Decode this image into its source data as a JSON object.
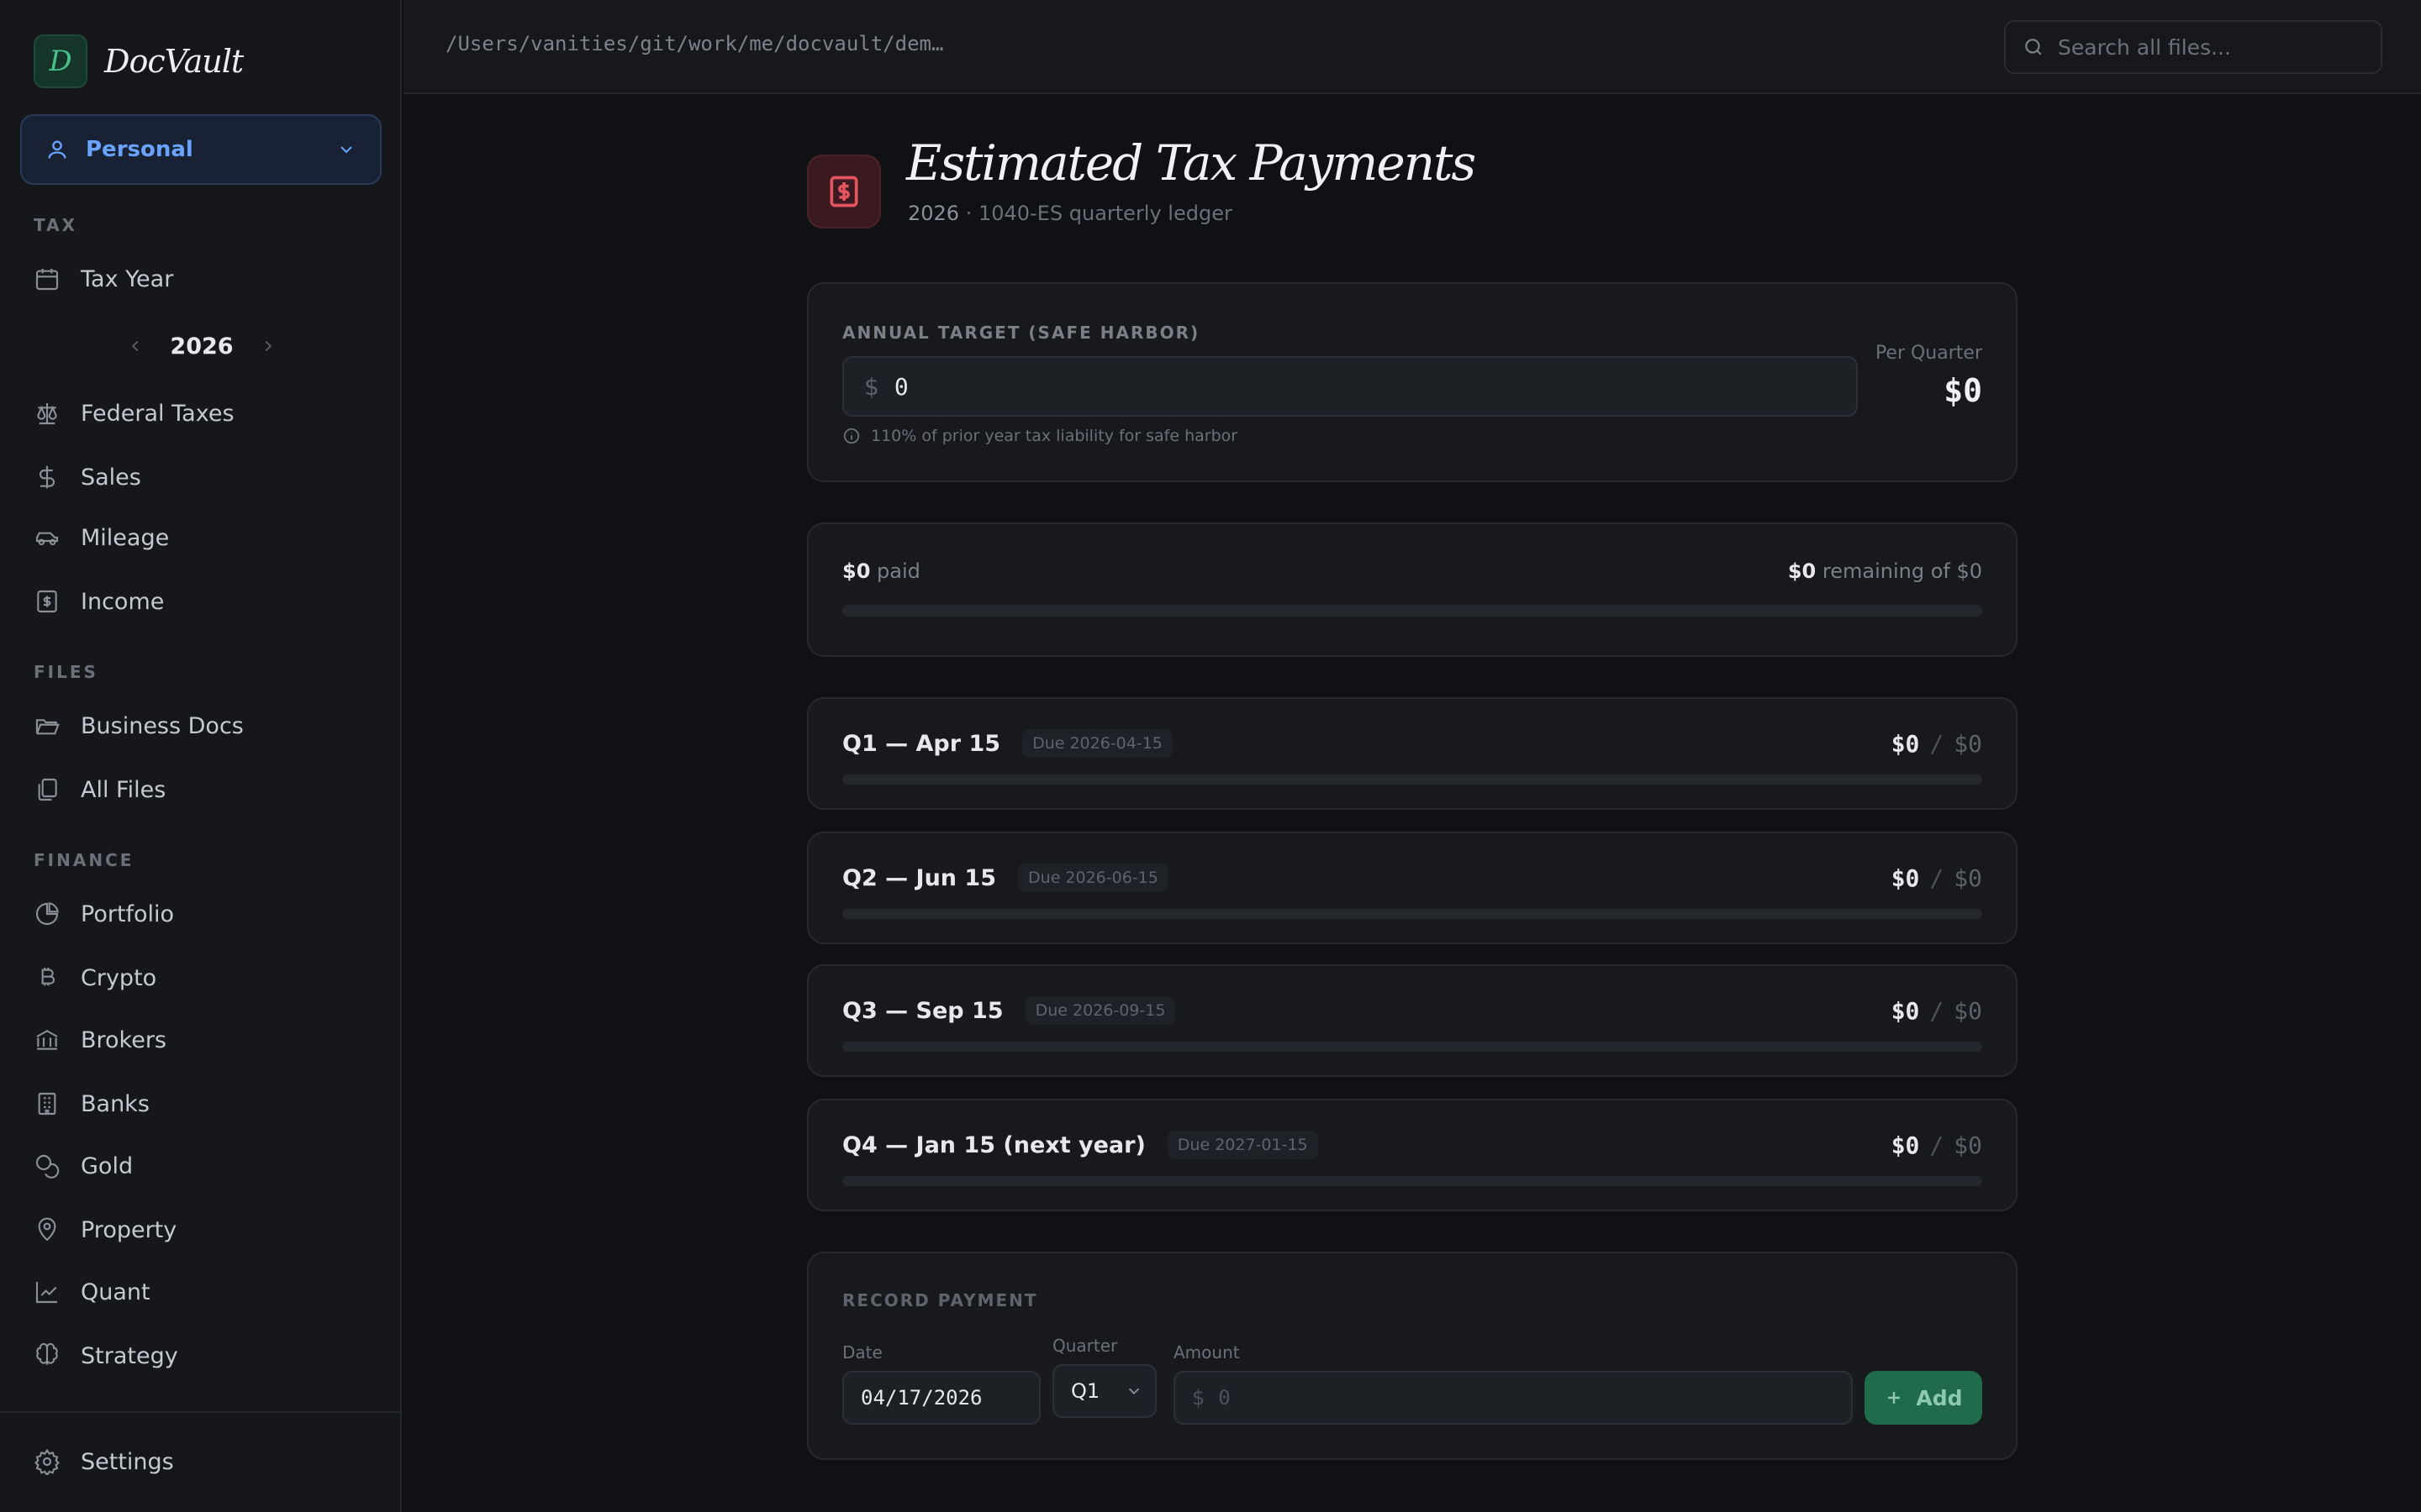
{
  "app": {
    "logo_letter": "D",
    "name": "DocVault"
  },
  "profile": {
    "label": "Personal"
  },
  "sidebar": {
    "sections": {
      "tax": "TAX",
      "files": "FILES",
      "finance": "FINANCE"
    },
    "tax_year_label": "Tax Year",
    "year": "2026",
    "items": {
      "federal_taxes": "Federal Taxes",
      "sales": "Sales",
      "mileage": "Mileage",
      "income": "Income",
      "business_docs": "Business Docs",
      "all_files": "All Files",
      "portfolio": "Portfolio",
      "crypto": "Crypto",
      "brokers": "Brokers",
      "banks": "Banks",
      "gold": "Gold",
      "property": "Property",
      "quant": "Quant",
      "strategy": "Strategy"
    },
    "settings": "Settings"
  },
  "topbar": {
    "path": "/Users/vanities/git/work/me/docvault/dem…",
    "search_placeholder": "Search all files..."
  },
  "page": {
    "title": "Estimated Tax Payments",
    "subtitle_year": "2026",
    "subtitle_rest": "· 1040-ES quarterly ledger"
  },
  "target": {
    "caption": "ANNUAL TARGET (SAFE HARBOR)",
    "currency": "$",
    "value": "0",
    "hint": "110% of prior year tax liability for safe harbor",
    "per_quarter_label": "Per Quarter",
    "per_quarter_value": "$0"
  },
  "progress": {
    "paid_amount": "$0",
    "paid_label": "paid",
    "remaining_amount": "$0",
    "remaining_label": "remaining of $0",
    "fraction": 0
  },
  "quarters": [
    {
      "title": "Q1 — Apr 15",
      "due": "Due 2026-04-15",
      "paid": "$0",
      "sep": "/",
      "target": "$0",
      "fraction": 0
    },
    {
      "title": "Q2 — Jun 15",
      "due": "Due 2026-06-15",
      "paid": "$0",
      "sep": "/",
      "target": "$0",
      "fraction": 0
    },
    {
      "title": "Q3 — Sep 15",
      "due": "Due 2026-09-15",
      "paid": "$0",
      "sep": "/",
      "target": "$0",
      "fraction": 0
    },
    {
      "title": "Q4 — Jan 15 (next year)",
      "due": "Due 2027-01-15",
      "paid": "$0",
      "sep": "/",
      "target": "$0",
      "fraction": 0
    }
  ],
  "record": {
    "caption": "RECORD PAYMENT",
    "date_label": "Date",
    "date_value": "04/17/2026",
    "quarter_label": "Quarter",
    "quarter_value": "Q1",
    "amount_label": "Amount",
    "amount_currency": "$",
    "amount_placeholder": "0",
    "add_label": "Add"
  },
  "colors": {
    "accent_green": "#2f9e6e",
    "accent_blue": "#6aa3ff",
    "accent_red": "#e5555f"
  }
}
